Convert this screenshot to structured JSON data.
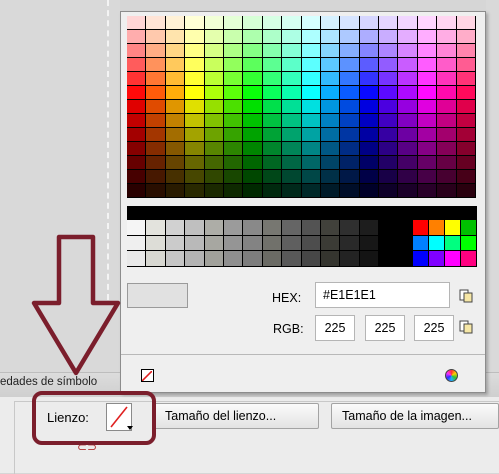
{
  "panel": {
    "tab_label": "edades de símbolo"
  },
  "properties": {
    "canvas_label": "Lienzo:",
    "canvas_size_button": "Tamaño del lienzo...",
    "image_size_button": "Tamaño de la imagen..."
  },
  "color_picker": {
    "hex_label": "HEX:",
    "hex_value": "#E1E1E1",
    "rgb_label": "RGB:",
    "rgb_r": "225",
    "rgb_g": "225",
    "rgb_b": "225",
    "preview_color": "#E1E1E1",
    "copy_icon": "copy-icon",
    "no_color_icon": "no-color-icon",
    "color_wheel_icon": "color-wheel-icon"
  },
  "colors": {
    "highlight": "#7b1e2c"
  }
}
